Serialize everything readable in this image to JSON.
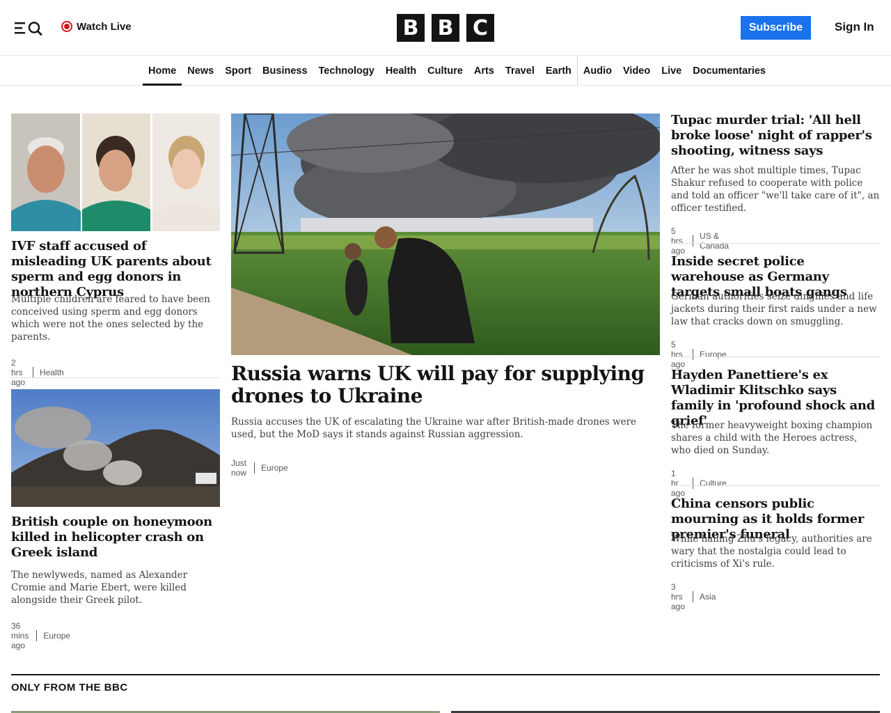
{
  "header": {
    "watch_live": "Watch Live",
    "logo_letters": [
      "B",
      "B",
      "C"
    ],
    "subscribe": "Subscribe",
    "sign_in": "Sign In"
  },
  "nav": {
    "items": [
      "Home",
      "News",
      "Sport",
      "Business",
      "Technology",
      "Health",
      "Culture",
      "Arts",
      "Travel",
      "Earth",
      "Audio",
      "Video",
      "Live",
      "Documentaries"
    ],
    "active": "Home"
  },
  "left_column": [
    {
      "headline": "IVF staff accused of misleading UK parents about sperm and egg donors in northern Cyprus",
      "summary": "Multiple children are feared to have been conceived using sperm and egg donors which were not the ones selected by the parents.",
      "time": "2 hrs ago",
      "category": "Health"
    },
    {
      "headline": "British couple on honeymoon killed in helicopter crash on Greek island",
      "summary": "The newlyweds, named as Alexander Cromie and Marie Ebert, were killed alongside their Greek pilot.",
      "time": "36 mins ago",
      "category": "Europe"
    }
  ],
  "lead_article": {
    "headline": "Russia warns UK will pay for supplying drones to Ukraine",
    "summary": "Russia accuses the UK of escalating the Ukraine war after British-made drones were used, but the MoD says it stands against Russian aggression.",
    "time": "Just now",
    "category": "Europe"
  },
  "right_column": [
    {
      "headline": "Tupac murder trial: 'All hell broke loose' night of rapper's shooting, witness says",
      "summary": "After he was shot multiple times, Tupac Shakur refused to cooperate with police and told an officer \"we'll take care of it\", an officer testified.",
      "time": "5 hrs ago",
      "category": "US & Canada"
    },
    {
      "headline": "Inside secret police warehouse as Germany targets small boats gangs",
      "summary": "German authorities seize dinghies and life jackets during their first raids under a new law that cracks down on smuggling.",
      "time": "5 hrs ago",
      "category": "Europe"
    },
    {
      "headline": "Hayden Panettiere's ex Wladimir Klitschko says family in 'profound shock and grief'",
      "summary": "The former heavyweight boxing champion shares a child with the Heroes actress, who died on Sunday.",
      "time": "1 hr ago",
      "category": "Culture"
    },
    {
      "headline": "China censors public mourning as it holds former premier's funeral",
      "summary": "While hailing Zhu's legacy, authorities are wary that the nostalgia could lead to criticisms of Xi's rule.",
      "time": "3 hrs ago",
      "category": "Asia"
    }
  ],
  "section": {
    "title": "ONLY FROM THE BBC"
  },
  "colors": {
    "subscribe_bg": "#1a72ec",
    "live_red": "#d01b1b",
    "text": "#141414"
  }
}
